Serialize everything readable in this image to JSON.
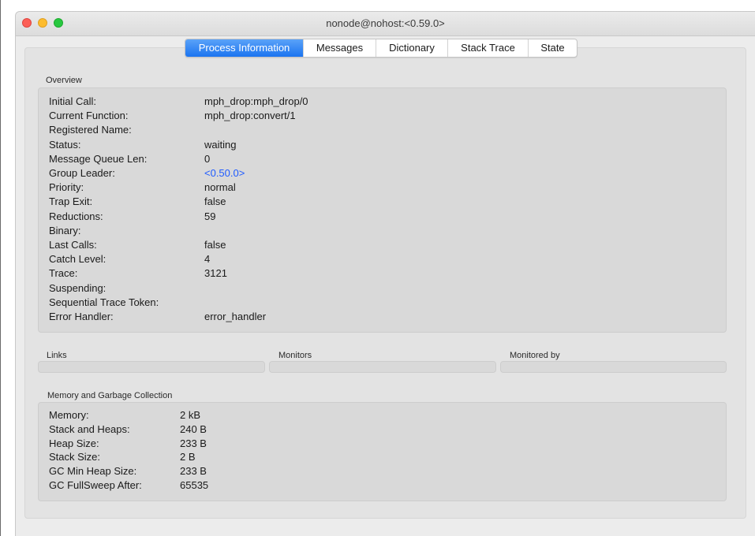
{
  "window": {
    "title": "nonode@nohost:<0.59.0>"
  },
  "tabs": [
    {
      "label": "Process Information",
      "active": true
    },
    {
      "label": "Messages",
      "active": false
    },
    {
      "label": "Dictionary",
      "active": false
    },
    {
      "label": "Stack Trace",
      "active": false
    },
    {
      "label": "State",
      "active": false
    }
  ],
  "overview": {
    "label": "Overview",
    "rows": [
      {
        "key": "Initial Call:",
        "value": "mph_drop:mph_drop/0"
      },
      {
        "key": "Current Function:",
        "value": "mph_drop:convert/1"
      },
      {
        "key": "Registered Name:",
        "value": ""
      },
      {
        "key": "Status:",
        "value": "waiting"
      },
      {
        "key": "Message Queue Len:",
        "value": "0"
      },
      {
        "key": "Group Leader:",
        "value": "<0.50.0>"
      },
      {
        "key": "Priority:",
        "value": "normal"
      },
      {
        "key": "Trap Exit:",
        "value": "false"
      },
      {
        "key": "Reductions:",
        "value": "59"
      },
      {
        "key": "Binary:",
        "value": ""
      },
      {
        "key": "Last Calls:",
        "value": "false"
      },
      {
        "key": "Catch Level:",
        "value": "4"
      },
      {
        "key": "Trace:",
        "value": "3121"
      },
      {
        "key": "Suspending:",
        "value": ""
      },
      {
        "key": "Sequential Trace Token:",
        "value": ""
      },
      {
        "key": "Error Handler:",
        "value": "error_handler"
      }
    ]
  },
  "relations": {
    "links_label": "Links",
    "monitors_label": "Monitors",
    "monitored_by_label": "Monitored by"
  },
  "memory": {
    "label": "Memory and Garbage Collection",
    "rows": [
      {
        "key": "Memory:",
        "value": "2 kB"
      },
      {
        "key": "Stack and Heaps:",
        "value": "240 B"
      },
      {
        "key": "Heap Size:",
        "value": "233 B"
      },
      {
        "key": "Stack Size:",
        "value": "2 B"
      },
      {
        "key": "GC Min Heap Size:",
        "value": "233 B"
      },
      {
        "key": "GC FullSweep After:",
        "value": "65535"
      }
    ]
  },
  "colors": {
    "active_tab": "#1b74f0",
    "link_text": "#1f5bff",
    "close_button": "#fc5f57",
    "minimize_button": "#fdbc2e",
    "zoom_button": "#28c840"
  }
}
